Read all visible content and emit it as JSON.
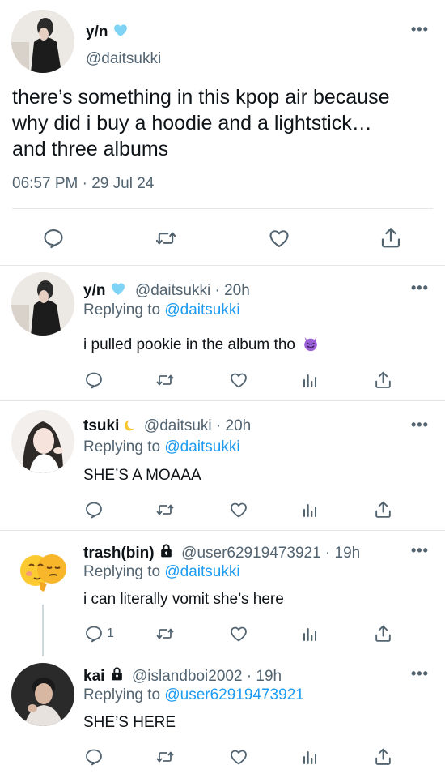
{
  "main_tweet": {
    "display_name": "y/n",
    "handle": "@daitsukki",
    "text_lines": [
      "there’s something in this kpop air because",
      "why did i buy a hoodie and a lightstick…",
      "and three albums"
    ],
    "timestamp": "06:57 PM · 29 Jul 24",
    "more": "•••"
  },
  "replies": [
    {
      "display_name": "y/n",
      "meta": "@daitsukki · 20h",
      "replying_prefix": "Replying to",
      "replying_to": "@daitsukki",
      "text": "i pulled pookie in the album tho",
      "more": "•••"
    },
    {
      "display_name": "tsuki",
      "meta": "@daitsuki · 20h",
      "replying_prefix": "Replying to",
      "replying_to": "@daitsukki",
      "text": "SHE’S A MOAAA",
      "more": "•••"
    },
    {
      "display_name": "trash(bin)",
      "meta": "@user62919473921 · 19h",
      "replying_prefix": "Replying to",
      "replying_to": "@daitsukki",
      "text": "i can literally vomit she’s here",
      "reply_count": "1",
      "more": "•••"
    },
    {
      "display_name": "kai",
      "meta": "@islandboi2002 · 19h",
      "replying_prefix": "Replying to",
      "replying_to": "@user62919473921",
      "text": "SHE’S HERE",
      "more": "•••"
    }
  ],
  "icons": {
    "reply": "reply-icon",
    "retweet": "retweet-icon",
    "like": "heart-icon",
    "views": "analytics-icon",
    "share": "share-icon",
    "verified": "verified-heart-icon",
    "lock": "lock-icon",
    "emoji_devil": "smiling-devil-emoji"
  },
  "colors": {
    "link": "#1d9bf0",
    "muted": "#536471",
    "verified": "#7fd3f5",
    "devil": "#9b5fd6"
  }
}
